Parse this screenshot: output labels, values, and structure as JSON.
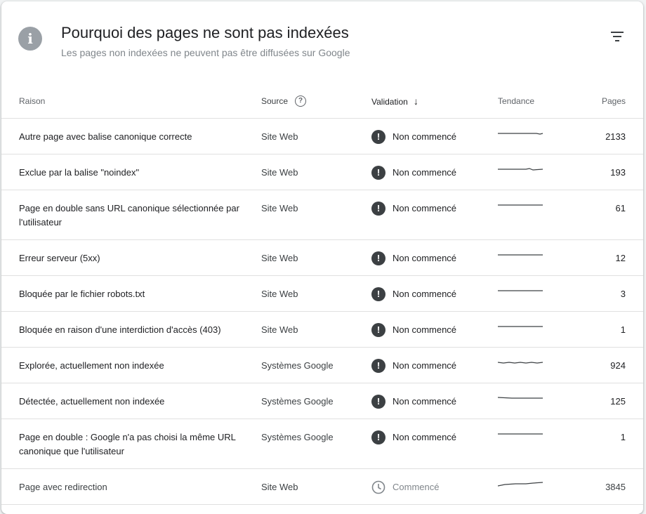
{
  "header": {
    "title": "Pourquoi des pages ne sont pas indexées",
    "subtitle": "Les pages non indexées ne peuvent pas être diffusées sur Google"
  },
  "columns": {
    "reason": "Raison",
    "source": "Source",
    "validation": "Validation",
    "trend": "Tendance",
    "pages": "Pages"
  },
  "rows": [
    {
      "reason": "Autre page avec balise canonique correcte",
      "source": "Site Web",
      "status": "Non commencé",
      "pages": "2133"
    },
    {
      "reason": "Exclue par la balise \"noindex\"",
      "source": "Site Web",
      "status": "Non commencé",
      "pages": "193"
    },
    {
      "reason": "Page en double sans URL canonique sélectionnée par l'utilisateur",
      "source": "Site Web",
      "status": "Non commencé",
      "pages": "61"
    },
    {
      "reason": "Erreur serveur (5xx)",
      "source": "Site Web",
      "status": "Non commencé",
      "pages": "12"
    },
    {
      "reason": "Bloquée par le fichier robots.txt",
      "source": "Site Web",
      "status": "Non commencé",
      "pages": "3"
    },
    {
      "reason": "Bloquée en raison d'une interdiction d'accès (403)",
      "source": "Site Web",
      "status": "Non commencé",
      "pages": "1"
    },
    {
      "reason": "Explorée, actuellement non indexée",
      "source": "Systèmes Google",
      "status": "Non commencé",
      "pages": "924"
    },
    {
      "reason": "Détectée, actuellement non indexée",
      "source": "Systèmes Google",
      "status": "Non commencé",
      "pages": "125"
    },
    {
      "reason": "Page en double : Google n'a pas choisi la même URL canonique que l'utilisateur",
      "source": "Systèmes Google",
      "status": "Non commencé",
      "pages": "1"
    },
    {
      "reason": "Page avec redirection",
      "source": "Site Web",
      "status": "Commencé",
      "pages": "3845"
    }
  ],
  "icons": {
    "header": "info-icon",
    "filter": "filter-icon",
    "source_help": "help-icon",
    "sort": "arrow-down-icon",
    "not_started": "exclamation-icon",
    "started": "clock-icon"
  },
  "colors": {
    "status_dark": "#3c4043",
    "status_muted": "#80868b",
    "info_icon": "#9aa0a6"
  }
}
